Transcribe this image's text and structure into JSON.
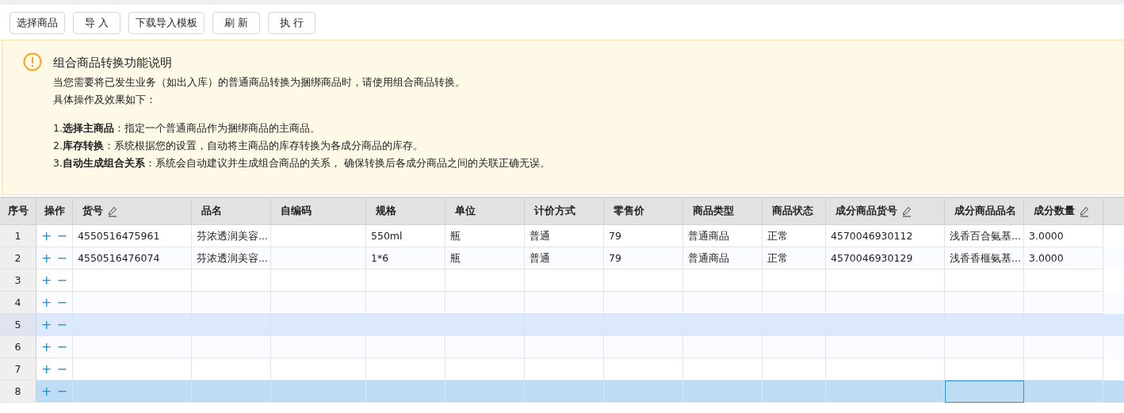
{
  "toolbar": {
    "buttons": [
      "选择商品",
      "导 入",
      "下载导入模板",
      "刷 新",
      "执 行"
    ]
  },
  "notice": {
    "title": "组合商品转换功能说明",
    "paragraphs": [
      "当您需要将已发生业务（如出入库）的普通商品转换为捆绑商品时，请使用组合商品转换。",
      "具体操作及效果如下："
    ],
    "steps": [
      "1.**选择主商品**：指定一个普通商品作为捆绑商品的主商品。",
      "2.**库存转换**：系统根据您的设置，自动将主商品的库存转换为各成分商品的库存。",
      "3.**自动生成组合关系**：系统会自动建议并生成组合商品的关系， 确保转换后各成分商品之间的关联正确无误。"
    ]
  },
  "table": {
    "columns": [
      {
        "label": "序号",
        "editable": false
      },
      {
        "label": "操作",
        "editable": false
      },
      {
        "label": "货号",
        "editable": true
      },
      {
        "label": "品名",
        "editable": false
      },
      {
        "label": "自编码",
        "editable": false
      },
      {
        "label": "规格",
        "editable": false
      },
      {
        "label": "单位",
        "editable": false
      },
      {
        "label": "计价方式",
        "editable": false
      },
      {
        "label": "零售价",
        "editable": false
      },
      {
        "label": "商品类型",
        "editable": false
      },
      {
        "label": "商品状态",
        "editable": false
      },
      {
        "label": "成分商品货号",
        "editable": true
      },
      {
        "label": "成分商品品名",
        "editable": false
      },
      {
        "label": "成分数量",
        "editable": true
      }
    ],
    "rows": [
      {
        "index": "1",
        "actions": [
          "+",
          "−"
        ],
        "selected": false,
        "hovered": false,
        "cells": [
          "4550516475961",
          "芬浓透润美容...",
          null,
          "550ml",
          "瓶",
          "普通",
          "79",
          "普通商品",
          "正常",
          "4570046930112",
          "浅香百合氨基...",
          "3.0000"
        ]
      },
      {
        "index": "2",
        "actions": [
          "+",
          "−"
        ],
        "selected": false,
        "hovered": false,
        "cells": [
          "4550516476074",
          "芬浓透润美容...",
          null,
          "1*6",
          "瓶",
          "普通",
          "79",
          "普通商品",
          "正常",
          "4570046930129",
          "浅香香榧氨基...",
          "3.0000"
        ]
      },
      {
        "index": "3",
        "actions": [
          "+",
          "−"
        ],
        "selected": false,
        "hovered": false
      },
      {
        "index": "4",
        "actions": [
          "+",
          "−"
        ],
        "selected": false,
        "hovered": false
      },
      {
        "index": "5",
        "actions": [
          "+",
          "−"
        ],
        "selected": false,
        "hovered": true
      },
      {
        "index": "6",
        "actions": [
          "+",
          "−"
        ],
        "selected": false,
        "hovered": false
      },
      {
        "index": "7",
        "actions": [
          "+",
          "−"
        ],
        "selected": false,
        "hovered": false
      },
      {
        "index": "8",
        "actions": [
          "+",
          "−"
        ],
        "selected": true,
        "hovered": false,
        "cell_focus": [
          false,
          false,
          false,
          false,
          false,
          false,
          false,
          false,
          false,
          false,
          true,
          false
        ]
      }
    ]
  }
}
